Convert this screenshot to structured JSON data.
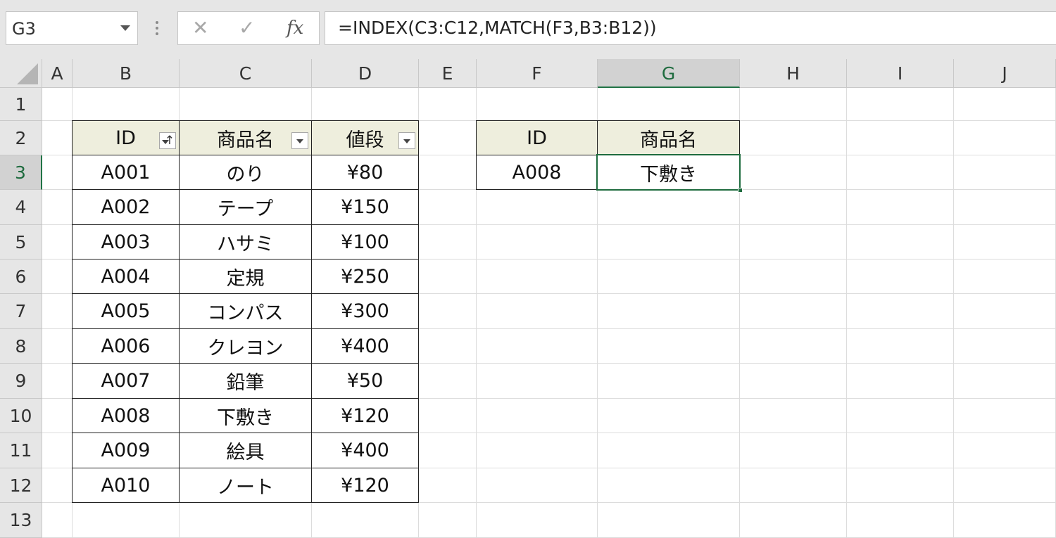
{
  "formula_bar": {
    "name_box": "G3",
    "cancel_icon": "close-icon",
    "enter_icon": "checkmark-icon",
    "fx_label": "fx",
    "formula": "=INDEX(C3:C12,MATCH(F3,B3:B12))"
  },
  "columns": [
    "A",
    "B",
    "C",
    "D",
    "E",
    "F",
    "G",
    "H",
    "I",
    "J"
  ],
  "rows": [
    "1",
    "2",
    "3",
    "4",
    "5",
    "6",
    "7",
    "8",
    "9",
    "10",
    "11",
    "12",
    "13"
  ],
  "active_cell": {
    "column": "G",
    "row": "3"
  },
  "table": {
    "headers": [
      "ID",
      "商品名",
      "値段"
    ],
    "rows": [
      [
        "A001",
        "のり",
        "¥80"
      ],
      [
        "A002",
        "テープ",
        "¥150"
      ],
      [
        "A003",
        "ハサミ",
        "¥100"
      ],
      [
        "A004",
        "定規",
        "¥250"
      ],
      [
        "A005",
        "コンパス",
        "¥300"
      ],
      [
        "A006",
        "クレヨン",
        "¥400"
      ],
      [
        "A007",
        "鉛筆",
        "¥50"
      ],
      [
        "A008",
        "下敷き",
        "¥120"
      ],
      [
        "A009",
        "絵具",
        "¥400"
      ],
      [
        "A010",
        "ノート",
        "¥120"
      ]
    ]
  },
  "lookup": {
    "headers": [
      "ID",
      "商品名"
    ],
    "values": [
      "A008",
      "下敷き"
    ]
  },
  "colors": {
    "header_fill": "#eeeedd",
    "selection_green": "#217346"
  }
}
